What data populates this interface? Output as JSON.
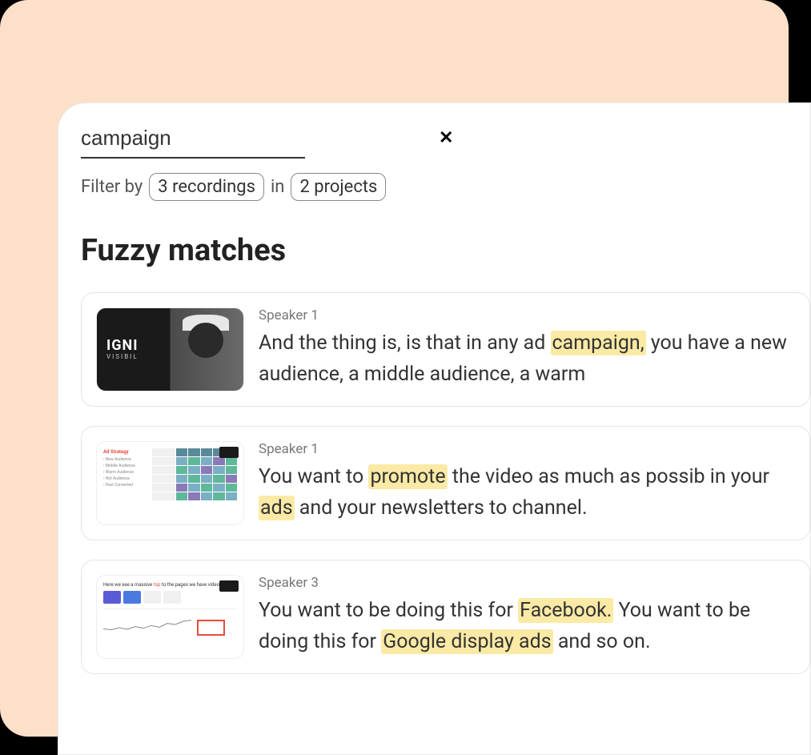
{
  "search": {
    "value": "campaign"
  },
  "filter": {
    "label": "Filter by",
    "recordings": "3 recordings",
    "connector": "in",
    "projects": "2 projects"
  },
  "section": {
    "heading": "Fuzzy matches"
  },
  "results": [
    {
      "speaker": "Speaker 1",
      "segments": [
        {
          "text": "And the thing is, is that in any ad ",
          "hl": false
        },
        {
          "text": "campaign,",
          "hl": true
        },
        {
          "text": " you have a new audience, a middle audience, a warm",
          "hl": false
        }
      ]
    },
    {
      "speaker": "Speaker 1",
      "segments": [
        {
          "text": "You want to ",
          "hl": false
        },
        {
          "text": "promote",
          "hl": true
        },
        {
          "text": " the video as much as possib in your ",
          "hl": false
        },
        {
          "text": "ads",
          "hl": true
        },
        {
          "text": " and your newsletters to channel.",
          "hl": false
        }
      ]
    },
    {
      "speaker": "Speaker 3",
      "segments": [
        {
          "text": "You want to be doing this for ",
          "hl": false
        },
        {
          "text": "Facebook.",
          "hl": true
        },
        {
          "text": " You want to be doing this for ",
          "hl": false
        },
        {
          "text": "Google display ads",
          "hl": true
        },
        {
          "text": " and so on.",
          "hl": false
        }
      ]
    }
  ]
}
